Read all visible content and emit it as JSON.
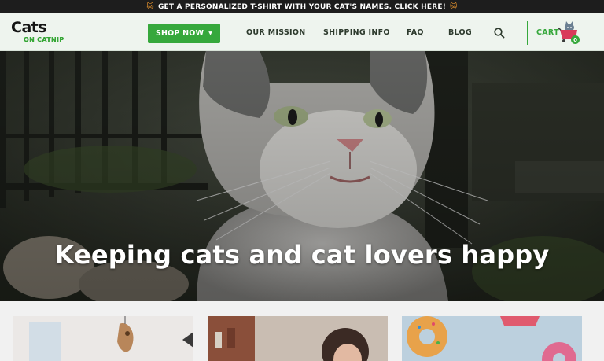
{
  "announcement": {
    "text": "GET A PERSONALIZED T-SHIRT WITH YOUR CAT'S NAMES. CLICK HERE!",
    "emoji": "🐱"
  },
  "header": {
    "logo": {
      "top": "Cats",
      "bottom": "ON CATNIP"
    },
    "shop_now": "SHOP NOW",
    "nav": {
      "mission": "OUR MISSION",
      "shipping": "SHIPPING INFO",
      "faq": "FAQ",
      "blog": "BLOG"
    },
    "cart_label": "CART",
    "cart_count": "0"
  },
  "hero": {
    "heading": "Keeping cats and cat lovers happy"
  },
  "colors": {
    "brand_green": "#36a83c",
    "announcement_bg": "#1d1d1d",
    "header_bg": "#eef4ee"
  },
  "icons": {
    "search": "search-icon",
    "cart": "shopping-cart-icon",
    "shop_caret": "chevron-down-icon"
  }
}
